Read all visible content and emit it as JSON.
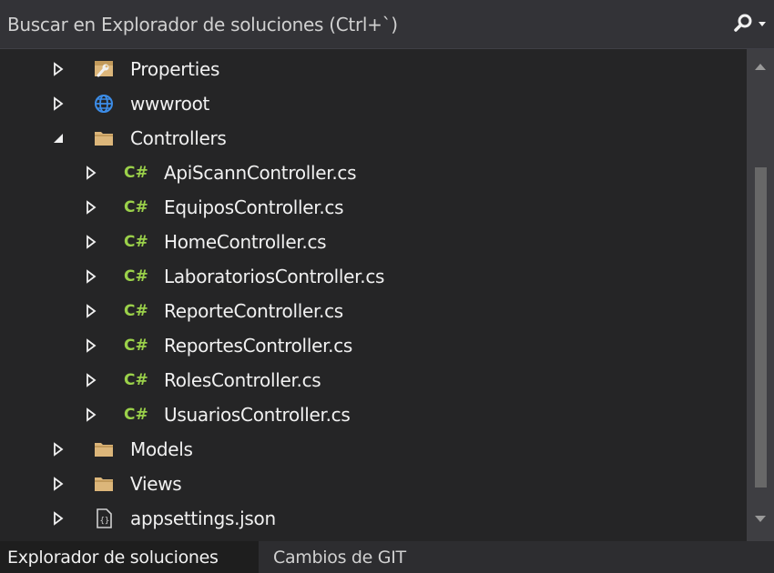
{
  "search": {
    "placeholder": "Buscar en Explorador de soluciones (Ctrl+`)",
    "icon": "search-icon"
  },
  "tree": {
    "items": [
      {
        "label": "Properties",
        "icon": "properties-wrench-icon",
        "expanded": false
      },
      {
        "label": "wwwroot",
        "icon": "globe-icon",
        "expanded": false
      },
      {
        "label": "Controllers",
        "icon": "folder-icon",
        "expanded": true
      },
      {
        "label": "ApiScannController.cs",
        "icon": "csharp-file-icon",
        "icon_text": "C#",
        "expanded": false
      },
      {
        "label": "EquiposController.cs",
        "icon": "csharp-file-icon",
        "icon_text": "C#",
        "expanded": false
      },
      {
        "label": "HomeController.cs",
        "icon": "csharp-file-icon",
        "icon_text": "C#",
        "expanded": false
      },
      {
        "label": "LaboratoriosController.cs",
        "icon": "csharp-file-icon",
        "icon_text": "C#",
        "expanded": false
      },
      {
        "label": "ReporteController.cs",
        "icon": "csharp-file-icon",
        "icon_text": "C#",
        "expanded": false
      },
      {
        "label": "ReportesController.cs",
        "icon": "csharp-file-icon",
        "icon_text": "C#",
        "expanded": false
      },
      {
        "label": "RolesController.cs",
        "icon": "csharp-file-icon",
        "icon_text": "C#",
        "expanded": false
      },
      {
        "label": "UsuariosController.cs",
        "icon": "csharp-file-icon",
        "icon_text": "C#",
        "expanded": false
      },
      {
        "label": "Models",
        "icon": "folder-icon",
        "expanded": false
      },
      {
        "label": "Views",
        "icon": "folder-icon",
        "expanded": false
      },
      {
        "label": "appsettings.json",
        "icon": "json-file-icon",
        "expanded": false
      }
    ]
  },
  "tabs": [
    {
      "label": "Explorador de soluciones",
      "active": true
    },
    {
      "label": "Cambios de GIT",
      "active": false
    }
  ],
  "colors": {
    "background": "#252526",
    "search_bar": "#333337",
    "text": "#f1f1f1",
    "csharp_icon": "#9bd14a",
    "folder": "#dcb67a",
    "globe": "#3c8de8"
  }
}
